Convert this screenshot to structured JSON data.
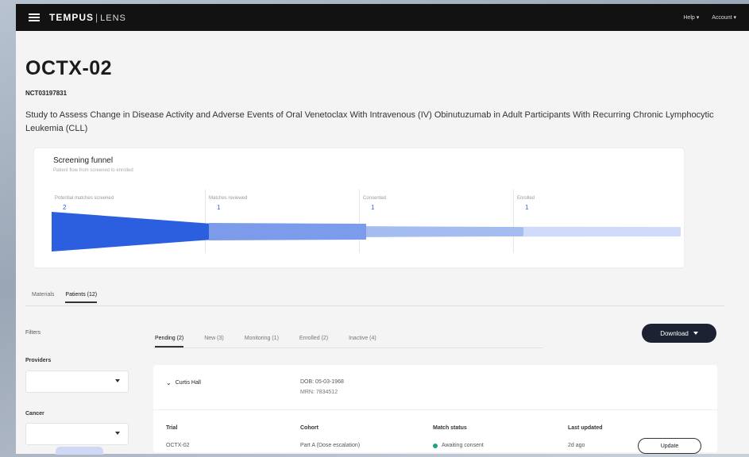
{
  "topbar": {
    "brand_main": "TEMPUS",
    "brand_sep": "|",
    "brand_sub": "LENS",
    "right_items": [
      "Help ▾",
      "Account ▾"
    ]
  },
  "trial": {
    "title": "OCTX-02",
    "nct_id": "NCT03197831",
    "description": "Study to Assess Change in Disease Activity and Adverse Events of Oral Venetoclax With Intravenous (IV) Obinutuzumab in Adult Participants With Recurring Chronic Lymphocytic Leukemia (CLL)"
  },
  "funnel": {
    "title": "Screening funnel",
    "subtitle": "Patient flow from screened to enrolled",
    "stages": [
      {
        "label": "Potential matches screened",
        "count": "2"
      },
      {
        "label": "Matches reviewed",
        "count": "1"
      },
      {
        "label": "Consented",
        "count": "1"
      },
      {
        "label": "Enrolled",
        "count": "1"
      }
    ],
    "fill_ratios": [
      1.0,
      0.55,
      0.42,
      0.25
    ],
    "colors": [
      "#2c5ee0",
      "#7c9ceb",
      "#a5bcf1",
      "#cfdbf8"
    ]
  },
  "main_tabs": [
    {
      "label": "Materials",
      "active": false
    },
    {
      "label": "Patients (12)",
      "active": true
    }
  ],
  "filters": {
    "heading": "Filters",
    "provider_label": "Providers",
    "cancer_label": "Cancer"
  },
  "patient_tabs": [
    {
      "label": "Pending (2)",
      "active": true
    },
    {
      "label": "New (3)",
      "active": false
    },
    {
      "label": "Monitoring (1)",
      "active": false
    },
    {
      "label": "Enrolled (2)",
      "active": false
    },
    {
      "label": "Inactive (4)",
      "active": false
    }
  ],
  "download_label": "Download",
  "patient": {
    "name": "Curtis Hall",
    "dob": "DOB: 05-03-1968",
    "mrn": "MRN: 7834512",
    "columns": [
      "Trial",
      "Cohort",
      "Match status",
      "Last updated"
    ],
    "row": {
      "trial": "OCTX-02",
      "cohort": "Part A (Dose escalation)",
      "status": "Awaiting consent",
      "updated": "2d ago"
    },
    "update_label": "Update"
  }
}
